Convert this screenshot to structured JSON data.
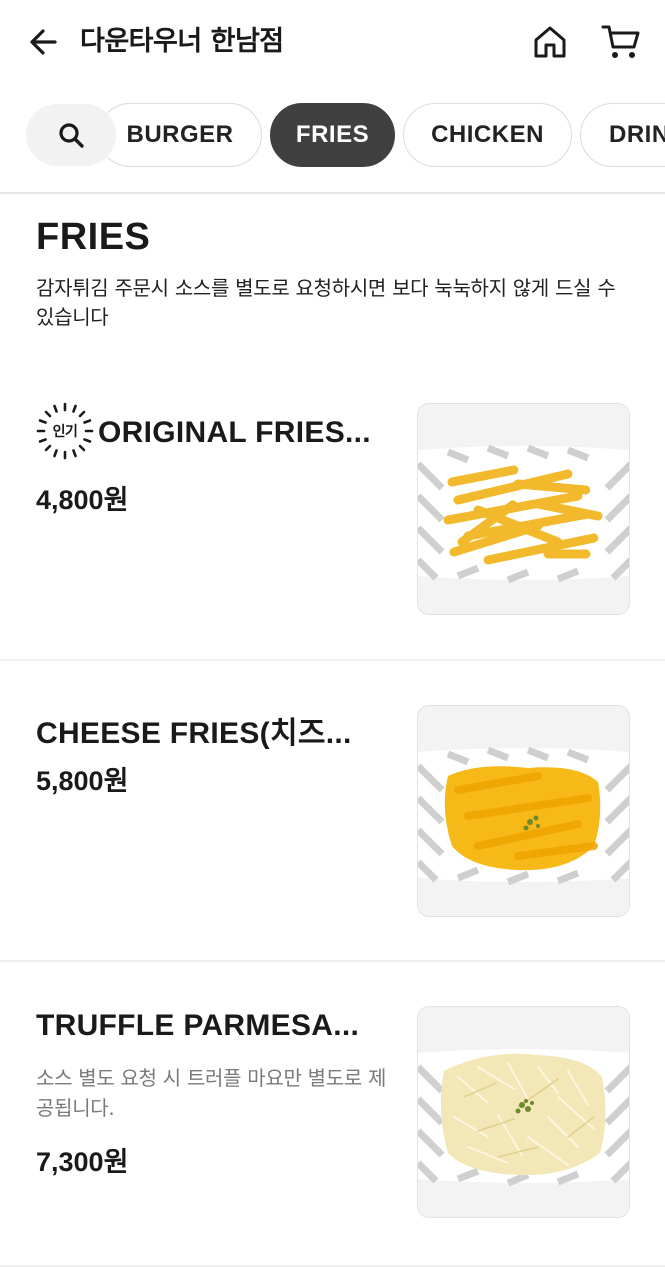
{
  "header": {
    "title": "다운타우너 한남점",
    "back_icon": "arrow-left-icon",
    "home_icon": "home-icon",
    "cart_icon": "cart-icon"
  },
  "tabs": {
    "search_icon": "search-icon",
    "items": [
      {
        "label": "BURGER",
        "active": false
      },
      {
        "label": "FRIES",
        "active": true
      },
      {
        "label": "CHICKEN",
        "active": false
      },
      {
        "label": "DRINK",
        "active": false
      }
    ]
  },
  "section": {
    "title": "FRIES",
    "description": "감자튀김 주문시 소스를 별도로 요청하시면 보다 눅눅하지 않게 드실 수 있습니다"
  },
  "menu": [
    {
      "name": "ORIGINAL FRIES...",
      "badge": "인기",
      "description": "",
      "price": "4,800원",
      "topping": "plain"
    },
    {
      "name": "CHEESE FRIES(치즈...",
      "badge": "",
      "description": "",
      "price": "5,800원",
      "topping": "cheese"
    },
    {
      "name": "TRUFFLE PARMESA...",
      "badge": "",
      "description": "소스 별도 요청 시 트러플 마요만 별도로 제공됩니다.",
      "price": "7,300원",
      "topping": "parmesan"
    }
  ],
  "colors": {
    "active_tab": "#404040",
    "fries": "#f2b92c",
    "cheese": "#f7b918",
    "parmesan": "#f3e7b8",
    "herb": "#6f8a2a"
  }
}
